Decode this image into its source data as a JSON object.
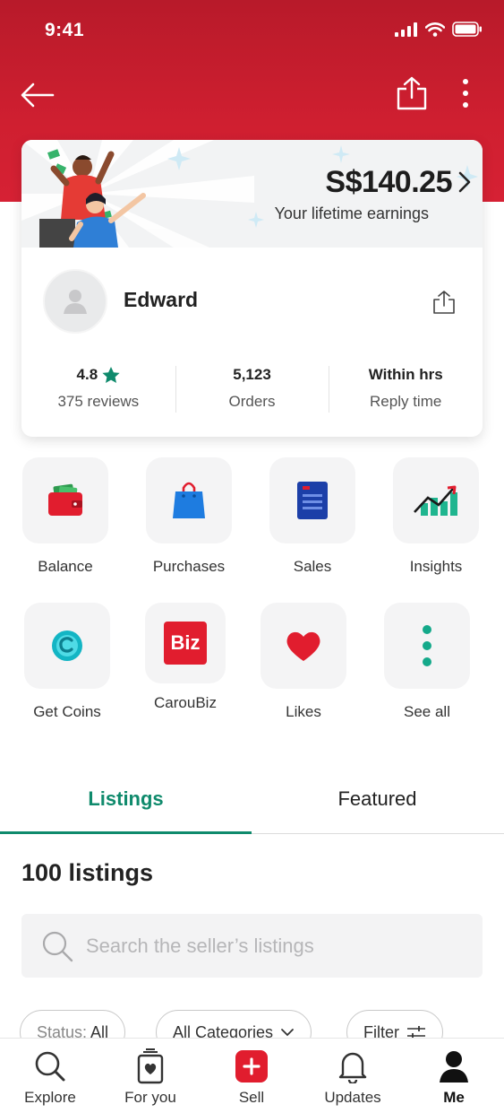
{
  "status_bar": {
    "time": "9:41"
  },
  "profile": {
    "earnings": "S$140.25",
    "earnings_label": "Your lifetime earnings",
    "name": "Edward",
    "stats": [
      {
        "value": "4.8",
        "label": "375 reviews"
      },
      {
        "value": "5,123",
        "label": "Orders"
      },
      {
        "value": "Within hrs",
        "label": "Reply time"
      }
    ]
  },
  "actions": [
    {
      "label": "Balance",
      "icon": "wallet-icon"
    },
    {
      "label": "Purchases",
      "icon": "shopping-bag-icon"
    },
    {
      "label": "Sales",
      "icon": "receipt-icon"
    },
    {
      "label": "Insights",
      "icon": "chart-up-icon"
    },
    {
      "label": "Get Coins",
      "icon": "coin-icon"
    },
    {
      "label": "CarouBiz",
      "icon": "biz-icon",
      "badge_text": "Biz"
    },
    {
      "label": "Likes",
      "icon": "heart-icon"
    },
    {
      "label": "See all",
      "icon": "more-vertical-icon"
    }
  ],
  "tabs": [
    {
      "label": "Listings"
    },
    {
      "label": "Featured"
    }
  ],
  "listings": {
    "count_label": "100 listings",
    "search_placeholder": "Search the seller’s listings",
    "filters": [
      {
        "prefix": "Status:",
        "label": "All"
      },
      {
        "label": "All Categories"
      },
      {
        "label": "Filter"
      }
    ]
  },
  "bottom_nav": [
    {
      "label": "Explore",
      "icon": "search-icon"
    },
    {
      "label": "For you",
      "icon": "for-you-icon"
    },
    {
      "label": "Sell",
      "icon": "sell-plus-icon"
    },
    {
      "label": "Updates",
      "icon": "bell-icon"
    },
    {
      "label": "Me",
      "icon": "person-icon",
      "active": true
    }
  ],
  "colors": {
    "brand_red": "#d62134",
    "accent_green": "#0f8a6c"
  }
}
